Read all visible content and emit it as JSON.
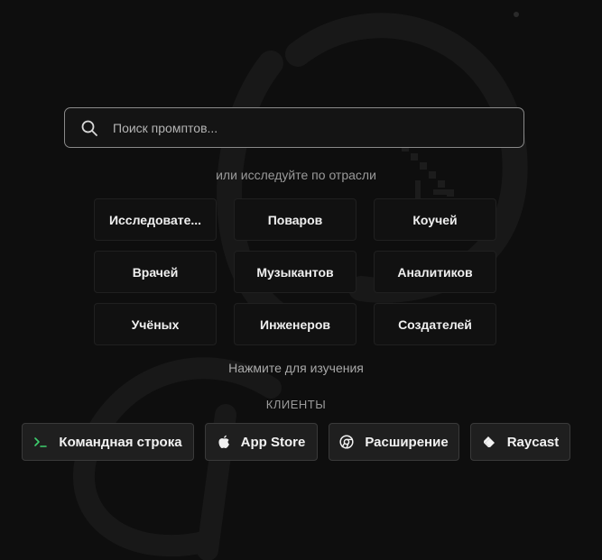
{
  "search": {
    "placeholder": "Поиск промптов..."
  },
  "subtitle": "или исследуйте по отрасли",
  "categories": [
    "Исследовате...",
    "Поваров",
    "Коучей",
    "Врачей",
    "Музыкантов",
    "Аналитиков",
    "Учёных",
    "Инженеров",
    "Создателей"
  ],
  "hint": "Нажмите для изучения",
  "clients": {
    "title": "КЛИЕНТЫ",
    "buttons": [
      {
        "label": "Командная строка",
        "icon": "terminal-icon"
      },
      {
        "label": "App Store",
        "icon": "apple-icon"
      },
      {
        "label": "Расширение",
        "icon": "chrome-icon"
      },
      {
        "label": "Raycast",
        "icon": "raycast-icon"
      }
    ]
  },
  "colors": {
    "background": "#0e0e0e",
    "terminal_accent": "#3ecf6e",
    "button_bg": "#1f1f1f"
  }
}
